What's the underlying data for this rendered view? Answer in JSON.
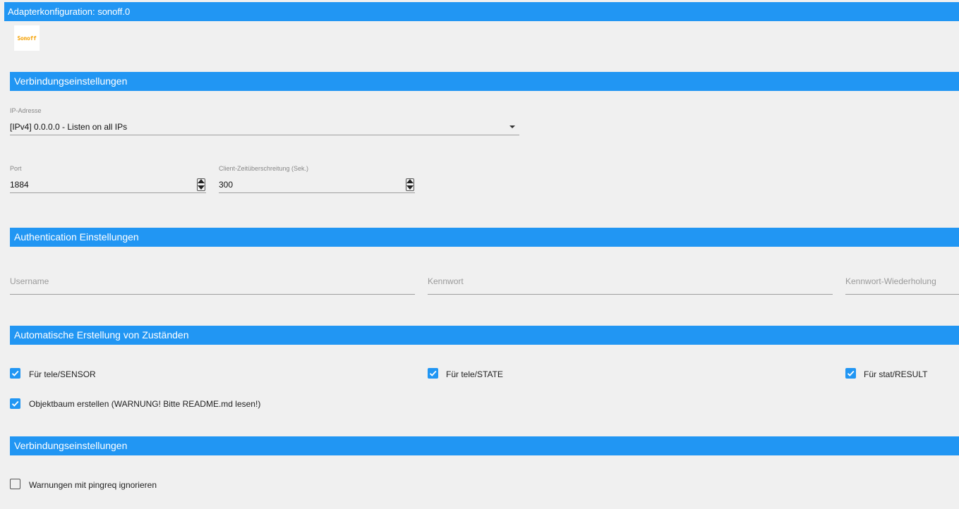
{
  "window": {
    "title": "Adapterkonfiguration: sonoff.0"
  },
  "logo": {
    "text": "Sonoff"
  },
  "sections": {
    "connection": "Verbindungseinstellungen",
    "auth": "Authentication Einstellungen",
    "auto": "Automatische Erstellung von Zuständen",
    "connection2": "Verbindungseinstellungen"
  },
  "ip": {
    "label": "IP-Adresse",
    "value": "[IPv4] 0.0.0.0 - Listen on all IPs"
  },
  "port": {
    "label": "Port",
    "value": "1884"
  },
  "timeout": {
    "label": "Client-Zeitüberschreitung (Sek.)",
    "value": "300"
  },
  "auth": {
    "username_placeholder": "Username",
    "password_placeholder": "Kennwort",
    "password_repeat_placeholder": "Kennwort-Wiederholung"
  },
  "checkboxes": {
    "tele_sensor": {
      "label": "Für tele/SENSOR",
      "checked": true
    },
    "tele_state": {
      "label": "Für tele/STATE",
      "checked": true
    },
    "stat_result": {
      "label": "Für stat/RESULT",
      "checked": true
    },
    "object_tree": {
      "label": "Objektbaum erstellen (WARNUNG! Bitte README.md lesen!)",
      "checked": true
    },
    "ignore_pingreq": {
      "label": "Warnungen mit pingreq ignorieren",
      "checked": false
    }
  },
  "colors": {
    "accent": "#2196f3",
    "logo": "#f5a000",
    "background": "#f0f0f0"
  }
}
